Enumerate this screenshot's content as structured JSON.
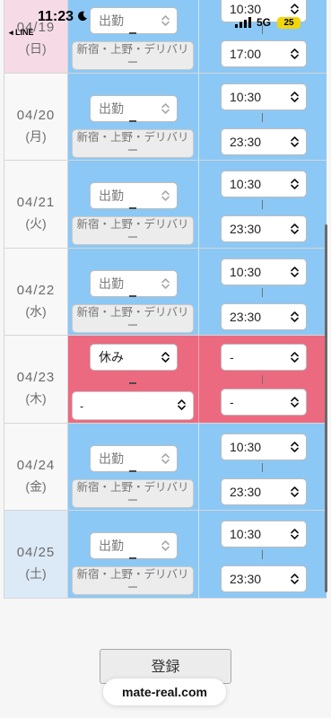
{
  "status_bar": {
    "time": "11:23",
    "back_label": "◂ LINE",
    "network": "5G",
    "battery": "25"
  },
  "shifts": [
    {
      "date": "04/19",
      "weekday": "(日)",
      "day_type": "sun",
      "status": "出勤",
      "area": "新宿・上野・デリバリー",
      "start": "10:30",
      "end": "17:00",
      "off": false
    },
    {
      "date": "04/20",
      "weekday": "(月)",
      "day_type": "weekday",
      "status": "出勤",
      "area": "新宿・上野・デリバリー",
      "start": "10:30",
      "end": "23:30",
      "off": false
    },
    {
      "date": "04/21",
      "weekday": "(火)",
      "day_type": "weekday",
      "status": "出勤",
      "area": "新宿・上野・デリバリー",
      "start": "10:30",
      "end": "23:30",
      "off": false
    },
    {
      "date": "04/22",
      "weekday": "(水)",
      "day_type": "weekday",
      "status": "出勤",
      "area": "新宿・上野・デリバリー",
      "start": "10:30",
      "end": "23:30",
      "off": false
    },
    {
      "date": "04/23",
      "weekday": "(木)",
      "day_type": "weekday",
      "status": "休み",
      "area": "-",
      "start": "-",
      "end": "-",
      "off": true
    },
    {
      "date": "04/24",
      "weekday": "(金)",
      "day_type": "weekday",
      "status": "出勤",
      "area": "新宿・上野・デリバリー",
      "start": "10:30",
      "end": "23:30",
      "off": false
    },
    {
      "date": "04/25",
      "weekday": "(土)",
      "day_type": "sat",
      "status": "出勤",
      "area": "新宿・上野・デリバリー",
      "start": "10:30",
      "end": "23:30",
      "off": false
    }
  ],
  "submit_label": "登録",
  "url": "mate-real.com",
  "colors": {
    "shift_blue": "#8cc8f5",
    "off_red": "#ec6a80",
    "saturday": "#dceaf7",
    "sunday": "#f6dbe7"
  }
}
